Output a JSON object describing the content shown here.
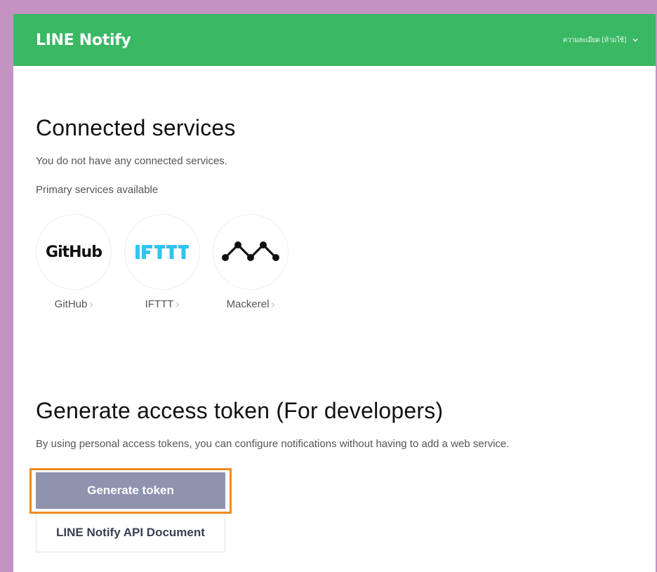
{
  "header": {
    "logo": "LINE Notify",
    "user_name": "ความละเอียด [ห้ามใช้]"
  },
  "connected": {
    "title": "Connected services",
    "empty_text": "You do not have any connected services.",
    "primary_label": "Primary services available",
    "services": [
      {
        "name": "GitHub",
        "logo_text": "GitHub"
      },
      {
        "name": "IFTTT",
        "logo_text": "IFTTT"
      },
      {
        "name": "Mackerel",
        "logo_text": ""
      }
    ]
  },
  "generate": {
    "title": "Generate access token (For developers)",
    "description": "By using personal access tokens, you can configure notifications without having to add a web service.",
    "generate_button": "Generate token",
    "api_doc_button": "LINE Notify API Document"
  },
  "colors": {
    "header_bg": "#3ab864",
    "generate_button_bg": "#8f93ae",
    "highlight": "#f08a1e",
    "ifttt_blue": "#33c3f0"
  }
}
